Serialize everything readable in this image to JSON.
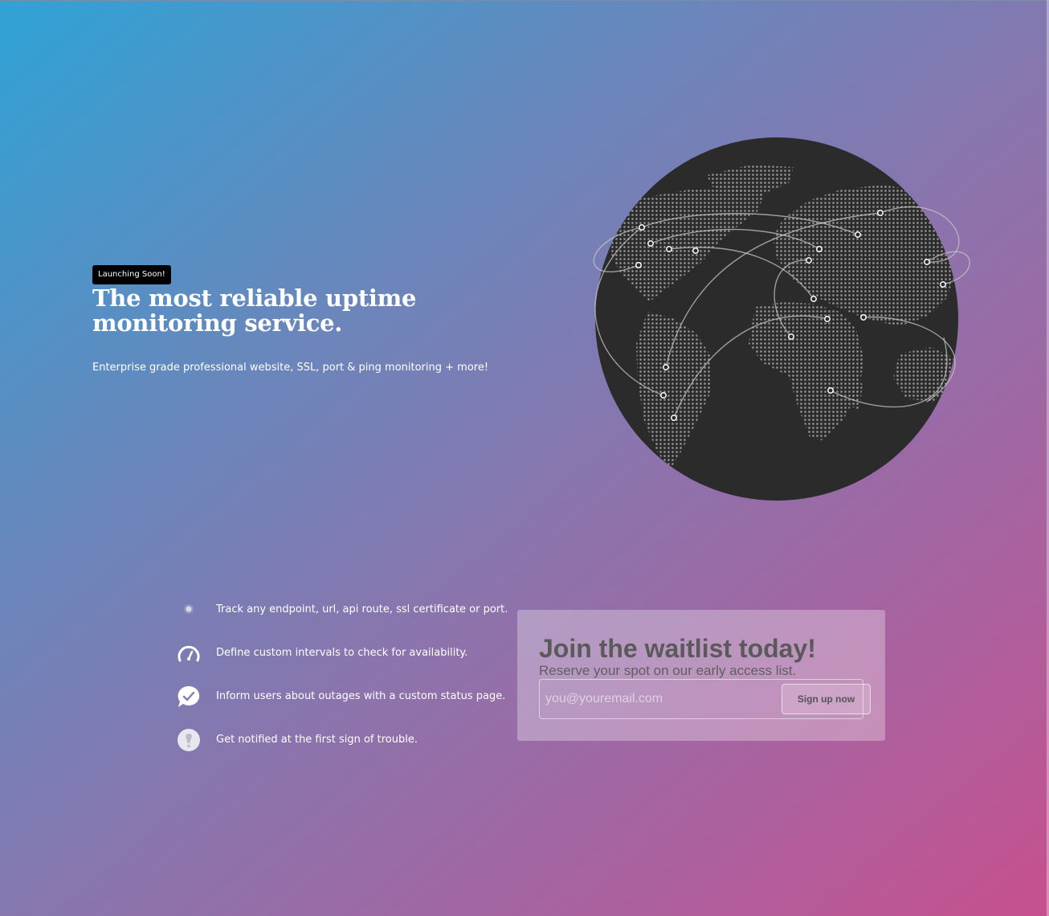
{
  "hero": {
    "badge": "Launching Soon!",
    "title": "The most reliable uptime monitoring service.",
    "subtitle": "Enterprise grade professional website, SSL, port & ping monitoring + more!"
  },
  "globe": {
    "icon": "world-map-globe-icon"
  },
  "features": [
    {
      "icon": "status-dot-icon",
      "text": "Track any endpoint, url, api route, ssl certificate or port."
    },
    {
      "icon": "speedometer-icon",
      "text": "Define custom intervals to check for availability."
    },
    {
      "icon": "chat-check-icon",
      "text": "Inform users about outages with a custom status page."
    },
    {
      "icon": "alert-bulb-icon",
      "text": "Get notified at the first sign of trouble."
    }
  ],
  "waitlist": {
    "title": "Join the waitlist today!",
    "subtitle": "Reserve your spot on our early access list.",
    "placeholder": "you@youremail.com",
    "button": "Sign up now"
  },
  "colors": {
    "gradient_start": "#2fa3d6",
    "gradient_end": "#c7508f",
    "globe": "#2b2b2b",
    "badge_bg": "#000000",
    "waitlist_text": "#5a5a5a"
  }
}
